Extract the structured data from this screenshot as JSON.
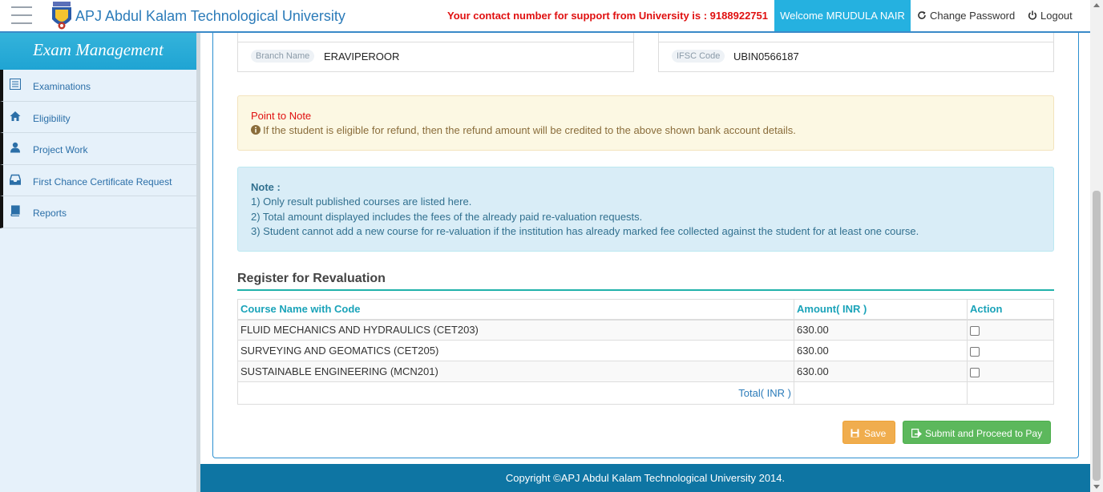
{
  "header": {
    "site_title": "APJ Abdul Kalam Technological University",
    "support_text": "Your contact number for support from University is : 9188922751",
    "welcome_text": "Welcome MRUDULA NAIR",
    "change_password": "Change Password",
    "logout": "Logout"
  },
  "sidebar": {
    "title": "Exam Management",
    "items": [
      {
        "label": "Examinations",
        "icon": "list-icon"
      },
      {
        "label": "Eligibility",
        "icon": "home-icon"
      },
      {
        "label": "Project Work",
        "icon": "user-icon"
      },
      {
        "label": "First Chance Certificate Request",
        "icon": "inbox-icon"
      },
      {
        "label": "Reports",
        "icon": "book-icon"
      }
    ]
  },
  "bank": {
    "branch_label": "Branch Name",
    "branch_value": "ERAVIPEROOR",
    "ifsc_label": "IFSC Code",
    "ifsc_value": "UBIN0566187"
  },
  "point_to_note": {
    "title": "Point to Note",
    "text": "If the student is eligible for refund, then the refund amount will be credited to the above shown bank account details."
  },
  "note": {
    "heading": "Note :",
    "lines": [
      "1) Only result published courses are listed here.",
      "2) Total amount displayed includes the fees of the already paid re-valuation requests.",
      "3) Student cannot add a new course for re-valuation if the institution has already marked fee collected against the student for at least one course."
    ]
  },
  "revaluation": {
    "title": "Register for Revaluation",
    "columns": [
      "Course Name with Code",
      "Amount( INR )",
      "Action"
    ],
    "rows": [
      {
        "course": "FLUID MECHANICS AND HYDRAULICS (CET203)",
        "amount": "630.00",
        "checked": false
      },
      {
        "course": "SURVEYING AND GEOMATICS (CET205)",
        "amount": "630.00",
        "checked": false
      },
      {
        "course": "SUSTAINABLE ENGINEERING (MCN201)",
        "amount": "630.00",
        "checked": false
      }
    ],
    "total_label": "Total( INR )",
    "total_value": ""
  },
  "buttons": {
    "save": "Save",
    "submit": "Submit and Proceed to Pay"
  },
  "footer": {
    "copyright": "Copyright ©APJ Abdul Kalam Technological University 2014."
  },
  "colors": {
    "accent": "#25b1e0",
    "footer": "#0e75a3",
    "support_red": "#e01010",
    "save_orange": "#f0ad4e",
    "submit_green": "#5cb85c"
  }
}
